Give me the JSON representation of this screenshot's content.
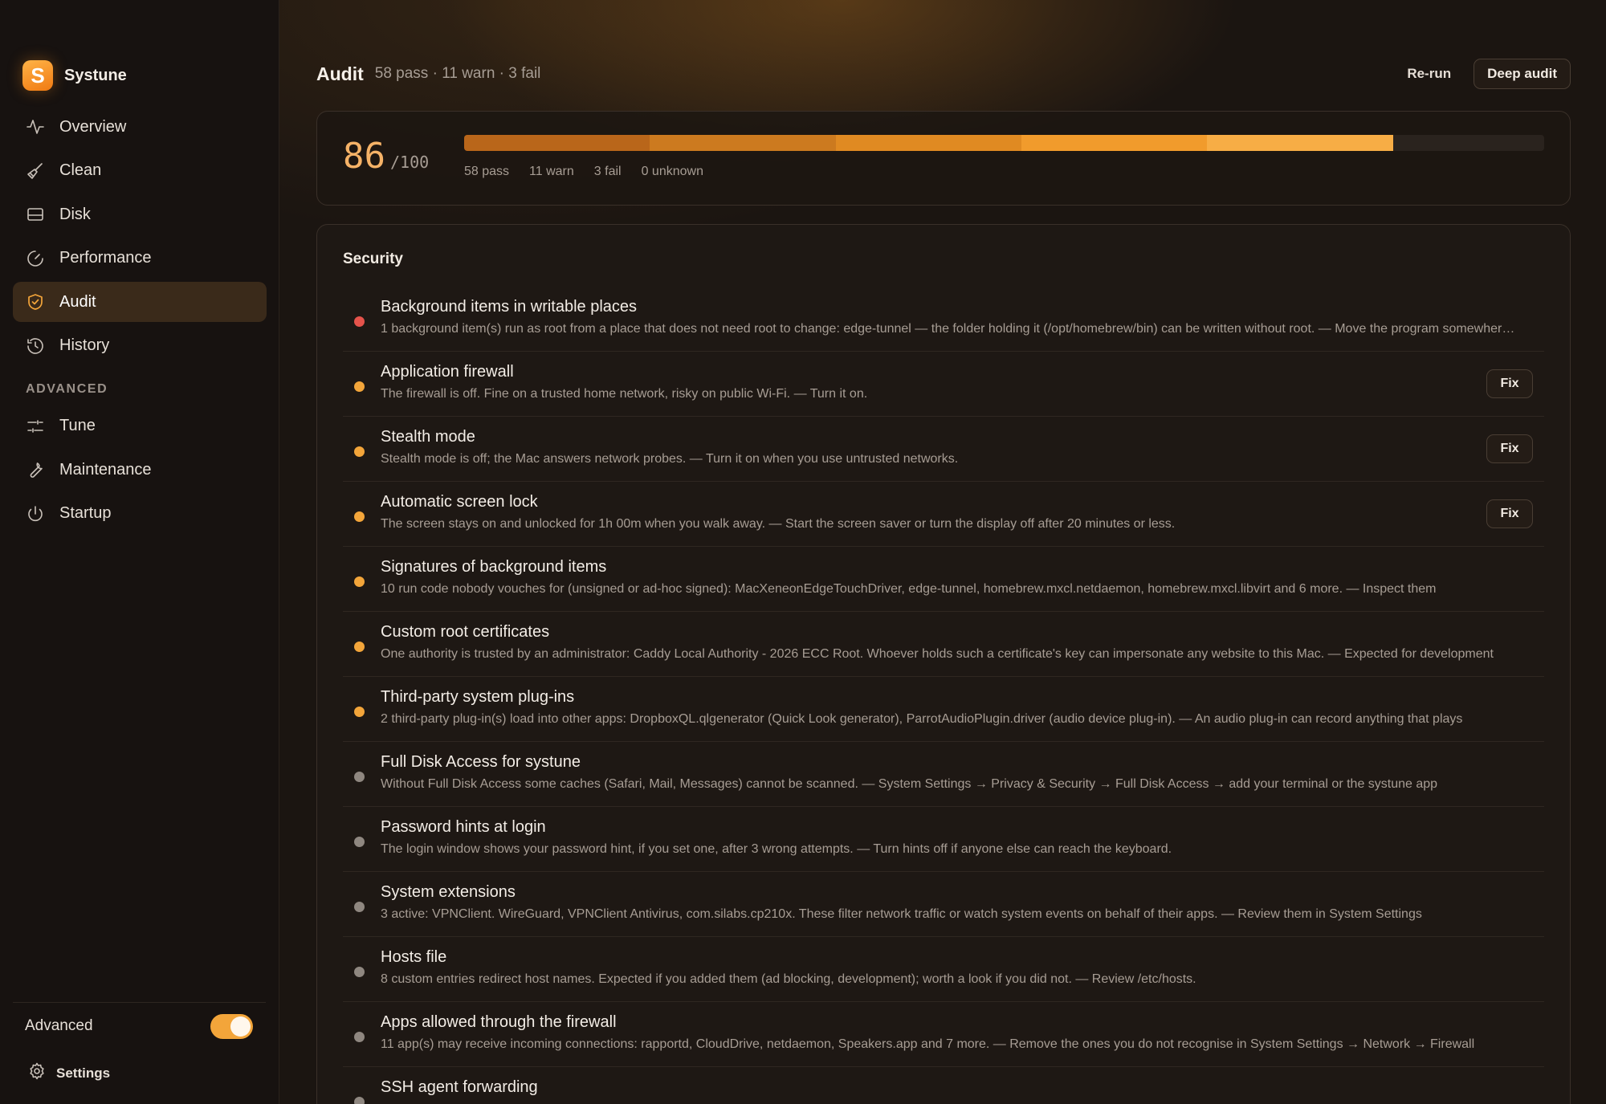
{
  "app": {
    "name": "Systune",
    "logo_letter": "S"
  },
  "colors": {
    "accent": "#f3a53a",
    "fail": "#e5534b",
    "warn": "#f3a53a",
    "neutral": "#8f8780",
    "progress": [
      "#b9661a",
      "#cc7a1f",
      "#e08a22",
      "#f19b2c",
      "#f7ad45"
    ]
  },
  "sidebar": {
    "nav": [
      {
        "id": "overview",
        "label": "Overview",
        "icon": "activity-icon"
      },
      {
        "id": "clean",
        "label": "Clean",
        "icon": "broom-icon"
      },
      {
        "id": "disk",
        "label": "Disk",
        "icon": "disk-icon"
      },
      {
        "id": "performance",
        "label": "Performance",
        "icon": "gauge-icon"
      },
      {
        "id": "audit",
        "label": "Audit",
        "icon": "shield-icon",
        "active": true
      },
      {
        "id": "history",
        "label": "History",
        "icon": "history-icon"
      }
    ],
    "advanced_heading": "ADVANCED",
    "advanced_nav": [
      {
        "id": "tune",
        "label": "Tune",
        "icon": "sliders-icon"
      },
      {
        "id": "maintenance",
        "label": "Maintenance",
        "icon": "wrench-icon"
      },
      {
        "id": "startup",
        "label": "Startup",
        "icon": "power-icon"
      }
    ],
    "advanced_toggle": {
      "label": "Advanced",
      "on": true
    },
    "settings_label": "Settings"
  },
  "header": {
    "title": "Audit",
    "summary": "58 pass · 11 warn · 3 fail",
    "rerun_label": "Re-run",
    "deep_audit_label": "Deep audit"
  },
  "score": {
    "value": "86",
    "max": "/100",
    "progress_fraction": 0.86,
    "legend": [
      "58 pass",
      "11 warn",
      "3 fail",
      "0 unknown"
    ]
  },
  "section": {
    "title": "Security",
    "fix_label": "Fix",
    "items": [
      {
        "status": "fail",
        "title": "Background items in writable places",
        "desc": "1 background item(s) run as root from a place that does not need root to change: edge-tunnel — the folder holding it (/opt/homebrew/bin) can be written without root. — Move the program somewhere only root can change",
        "fix": false
      },
      {
        "status": "warn",
        "title": "Application firewall",
        "desc": "The firewall is off. Fine on a trusted home network, risky on public Wi-Fi. — Turn it on.",
        "fix": true
      },
      {
        "status": "warn",
        "title": "Stealth mode",
        "desc": "Stealth mode is off; the Mac answers network probes. — Turn it on when you use untrusted networks.",
        "fix": true
      },
      {
        "status": "warn",
        "title": "Automatic screen lock",
        "desc": "The screen stays on and unlocked for 1h 00m when you walk away. — Start the screen saver or turn the display off after 20 minutes or less.",
        "fix": true
      },
      {
        "status": "warn",
        "title": "Signatures of background items",
        "desc": "10 run code nobody vouches for (unsigned or ad-hoc signed): MacXeneonEdgeTouchDriver, edge-tunnel, homebrew.mxcl.netdaemon, homebrew.mxcl.libvirt and 6 more. — Inspect them",
        "fix": false
      },
      {
        "status": "warn",
        "title": "Custom root certificates",
        "desc": "One authority is trusted by an administrator: Caddy Local Authority - 2026 ECC Root. Whoever holds such a certificate's key can impersonate any website to this Mac. — Expected for development",
        "fix": false
      },
      {
        "status": "warn",
        "title": "Third-party system plug-ins",
        "desc": "2 third-party plug-in(s) load into other apps: DropboxQL.qlgenerator (Quick Look generator), ParrotAudioPlugin.driver (audio device plug-in). — An audio plug-in can record anything that plays",
        "fix": false
      },
      {
        "status": "neutral",
        "title": "Full Disk Access for systune",
        "desc": "Without Full Disk Access some caches (Safari, Mail, Messages) cannot be scanned. — System Settings → Privacy & Security → Full Disk Access → add your terminal or the systune app",
        "fix": false
      },
      {
        "status": "neutral",
        "title": "Password hints at login",
        "desc": "The login window shows your password hint, if you set one, after 3 wrong attempts. — Turn hints off if anyone else can reach the keyboard.",
        "fix": false
      },
      {
        "status": "neutral",
        "title": "System extensions",
        "desc": "3 active: VPNClient. WireGuard, VPNClient Antivirus, com.silabs.cp210x. These filter network traffic or watch system events on behalf of their apps. — Review them in System Settings",
        "fix": false
      },
      {
        "status": "neutral",
        "title": "Hosts file",
        "desc": "8 custom entries redirect host names. Expected if you added them (ad blocking, development); worth a look if you did not. — Review /etc/hosts.",
        "fix": false
      },
      {
        "status": "neutral",
        "title": "Apps allowed through the firewall",
        "desc": "11 app(s) may receive incoming connections: rapportd, CloudDrive, netdaemon, Speakers.app and 7 more. — Remove the ones you do not recognise in System Settings → Network → Firewall",
        "fix": false
      },
      {
        "status": "neutral",
        "title": "SSH agent forwarding",
        "desc": "",
        "fix": false
      }
    ]
  }
}
